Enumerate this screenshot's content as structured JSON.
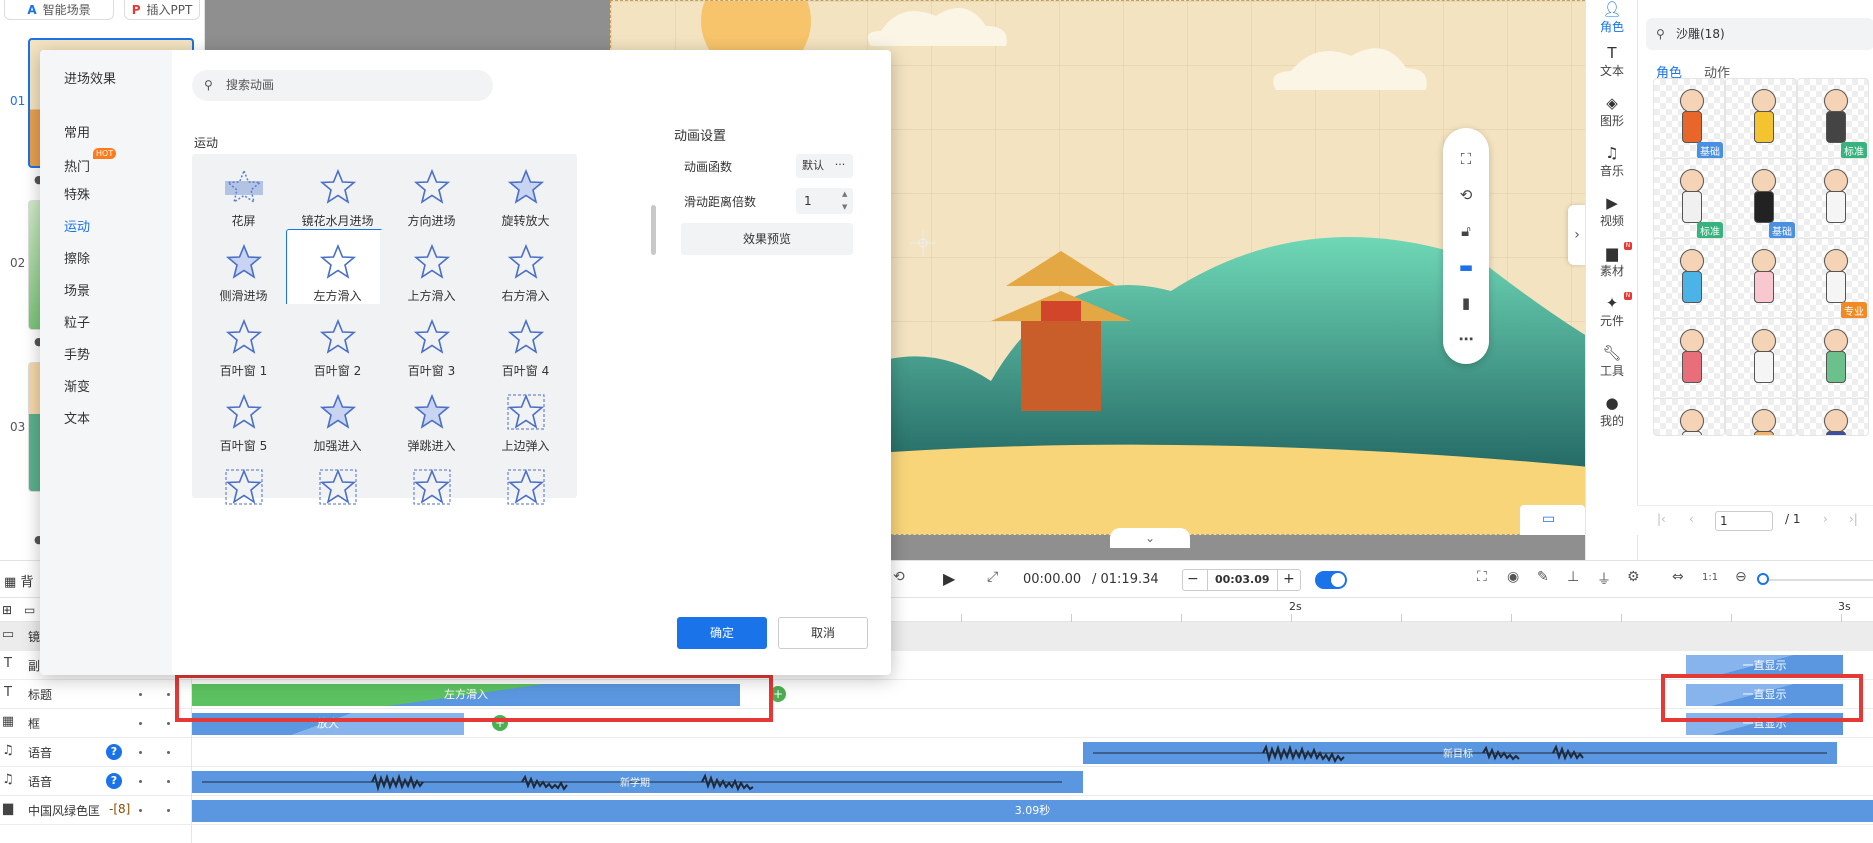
{
  "slides": {
    "top_buttons": [
      "智能场景",
      "插入PPT"
    ],
    "items": [
      {
        "num": "01"
      },
      {
        "num": "02"
      },
      {
        "num": "03"
      }
    ]
  },
  "floating_toolbar": {
    "icons": [
      "fit-screen-icon",
      "rotate-icon",
      "unlock-icon",
      "desktop-icon",
      "mobile-icon",
      "more-icon"
    ]
  },
  "right_nav": {
    "items": [
      {
        "label": "角色",
        "icon": "person-icon",
        "active": true
      },
      {
        "label": "文本",
        "icon": "text-icon"
      },
      {
        "label": "图形",
        "icon": "shape-icon"
      },
      {
        "label": "音乐",
        "icon": "music-icon"
      },
      {
        "label": "视频",
        "icon": "video-icon"
      },
      {
        "label": "素材",
        "icon": "folder-icon",
        "new": true
      },
      {
        "label": "元件",
        "icon": "component-icon",
        "new": true
      },
      {
        "label": "工具",
        "icon": "wrench-icon"
      },
      {
        "label": "我的",
        "icon": "user-icon"
      }
    ]
  },
  "char_panel": {
    "search_value": "沙雕(18)",
    "tabs": [
      "角色",
      "动作"
    ],
    "badges": [
      "基础",
      "",
      "标准",
      "标准",
      "基础",
      "",
      "",
      "",
      "专业",
      "",
      "",
      "",
      "",
      "",
      ""
    ],
    "pager": {
      "current": "1",
      "total": "/ 1"
    }
  },
  "dialog": {
    "title": "进场效果",
    "categories": [
      "常用",
      "热门",
      "特殊",
      "运动",
      "擦除",
      "场景",
      "粒子",
      "手势",
      "渐变",
      "文本"
    ],
    "active_category": "运动",
    "hot_badge": "HOT",
    "search_placeholder": "搜索动画",
    "section_title": "运动",
    "effects": [
      "花屏",
      "镜花水月进场",
      "方向进场",
      "旋转放大",
      "侧滑进场",
      "左方滑入",
      "上方滑入",
      "右方滑入",
      "百叶窗 1",
      "百叶窗 2",
      "百叶窗 3",
      "百叶窗 4",
      "百叶窗 5",
      "加强进入",
      "弹跳进入",
      "上边弹入",
      "",
      "",
      "",
      ""
    ],
    "selected_effect": "左方滑入",
    "settings": {
      "title": "动画设置",
      "func_label": "动画函数",
      "func_value": "默认",
      "func_more": "···",
      "distance_label": "滑动距离倍数",
      "distance_value": "1",
      "preview_label": "效果预览"
    },
    "ok_label": "确定",
    "cancel_label": "取消"
  },
  "playback": {
    "current_time": "00:00.00",
    "total_time": "/ 01:19.34",
    "duration": "00:03.09",
    "minus": "−",
    "plus": "+"
  },
  "timeline": {
    "ruler_labels": [
      "2s",
      "3s"
    ],
    "rows": [
      {
        "label": "镜",
        "icon": "camera-icon"
      },
      {
        "label": "副",
        "icon": "text-t-icon"
      },
      {
        "label": "标题",
        "icon": "text-t-icon"
      },
      {
        "label": "框",
        "icon": "frame-icon"
      },
      {
        "label": "语音",
        "icon": "note-icon",
        "help": true
      },
      {
        "label": "语音",
        "icon": "note-icon",
        "help": true
      },
      {
        "label": "中国风绿色匡",
        "icon": "folder-icon",
        "extra": "-[8]"
      }
    ],
    "clips": {
      "subtitle_right": "一直显示",
      "title_clip": "左方滑入",
      "title_right": "一直显示",
      "frame_clip": "放大",
      "frame_right": "一直显示",
      "voice1_clip": "新目标",
      "voice2_clip": "新学期",
      "scene_clip": "3.09秒"
    },
    "partial_labels": {
      "bg_tab": "背"
    }
  },
  "colors": {
    "accent": "#1a73e8",
    "highlight": "#e53935",
    "clip": "#5b97e0",
    "green": "#4caf50"
  }
}
